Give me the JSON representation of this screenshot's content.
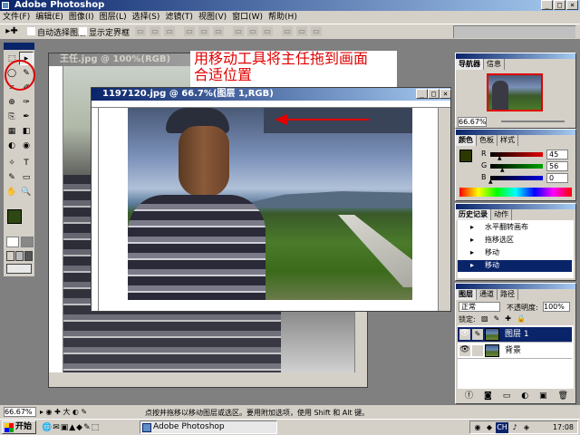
{
  "app": {
    "title": "Adobe Photoshop",
    "window_buttons": {
      "minimize": "_",
      "maximize": "□",
      "close": "×"
    }
  },
  "menu": [
    "文件(F)",
    "编辑(E)",
    "图像(I)",
    "图层(L)",
    "选择(S)",
    "滤镜(T)",
    "视图(V)",
    "窗口(W)",
    "帮助(H)"
  ],
  "options_bar": {
    "auto_select": "自动选择图层",
    "show_bounds": "显示定界框"
  },
  "tools": [
    [
      "⬚",
      "▸"
    ],
    [
      "◯",
      "✎"
    ],
    [
      "⌗",
      "✐"
    ],
    [
      "⊕",
      "✑"
    ],
    [
      "⎘",
      "✒"
    ],
    [
      "▦",
      "◧"
    ],
    [
      "◐",
      "◉"
    ],
    [
      "✧",
      "T"
    ],
    [
      "✎",
      "▭"
    ],
    [
      "✋",
      "🔍"
    ]
  ],
  "background_doc": {
    "title": "王任.jpg @ 100%(RGB)"
  },
  "annotation": {
    "line1": "用移动工具将主任拖到画面",
    "line2": "合适位置",
    "accent": "#e00000"
  },
  "doc": {
    "title": "1197120.jpg @ 66.7%(图层 1,RGB)"
  },
  "navigator": {
    "tabs": [
      "导航器",
      "信息"
    ],
    "zoom": "66.67%"
  },
  "color_panel": {
    "tabs": [
      "颜色",
      "色板",
      "样式"
    ],
    "r_label": "R",
    "g_label": "G",
    "b_label": "B",
    "r": "45",
    "g": "56",
    "b": "0",
    "r_level": 0.18,
    "g_level": 0.22,
    "b_level": 0.0,
    "fg_color": "#2d3800"
  },
  "history": {
    "tabs": [
      "历史记录",
      "动作"
    ],
    "items": [
      "水平翻转画布",
      "拖移选区",
      "移动",
      "移动"
    ],
    "active_index": 3
  },
  "layers": {
    "tabs": [
      "图层",
      "通道",
      "路径"
    ],
    "mode": "正常",
    "opacity_label": "不透明度:",
    "opacity": "100%",
    "lock_label": "锁定:",
    "items": [
      {
        "name": "图层 1",
        "active": true
      },
      {
        "name": "背景",
        "active": false
      }
    ]
  },
  "status": {
    "zoom": "66.67%",
    "hint": "点按并拖移以移动图层或选区。要用附加选项，使用 Shift 和 Alt 键。"
  },
  "taskbar": {
    "start": "开始",
    "task": "Adobe Photoshop",
    "time": "17:08",
    "ime": "CH"
  }
}
